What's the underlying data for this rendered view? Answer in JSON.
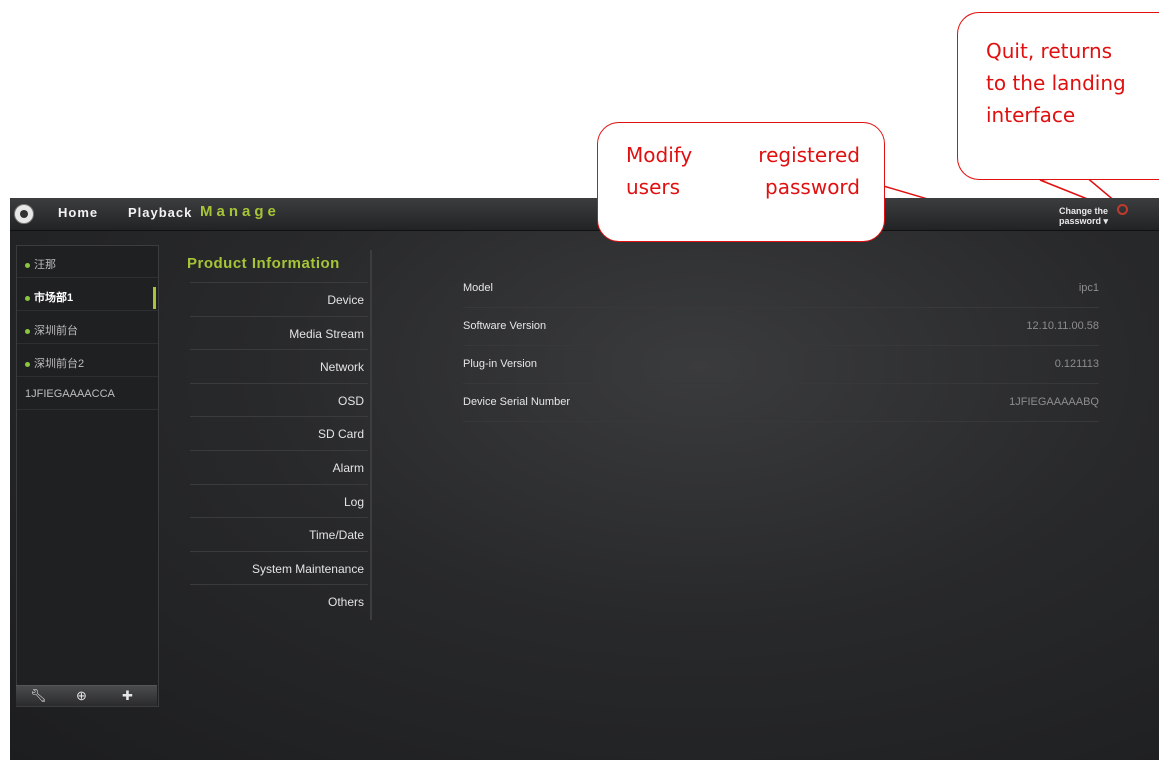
{
  "nav": {
    "home": "Home",
    "playback": "Playback",
    "manage": "Manage",
    "change_password_line1": "Change the",
    "change_password_line2": "password ▾"
  },
  "devices": [
    {
      "label": "汪那",
      "status": "online",
      "selected": false
    },
    {
      "label": "市场部1",
      "status": "online",
      "selected": true
    },
    {
      "label": "深圳前台",
      "status": "online",
      "selected": false
    },
    {
      "label": "深圳前台2",
      "status": "online",
      "selected": false
    },
    {
      "label": "1JFIEGAAAACCA",
      "status": "none",
      "selected": false
    }
  ],
  "device_toolbar": [
    "wrench-icon",
    "zoom-icon",
    "add-icon"
  ],
  "menu": {
    "heading": "Product Information",
    "items": [
      "Device",
      "Media Stream",
      "Network",
      "OSD",
      "SD Card",
      "Alarm",
      "Log",
      "Time/Date",
      "System Maintenance",
      "Others"
    ]
  },
  "info": [
    {
      "label": "Model",
      "value": "ipc1"
    },
    {
      "label": "Software Version",
      "value": "12.10.11.00.58"
    },
    {
      "label": "Plug-in Version",
      "value": "0.121113"
    },
    {
      "label": "Device Serial Number",
      "value": "1JFIEGAAAAABQ"
    }
  ],
  "callouts": {
    "password": "Modify registered users password",
    "quit_line1": "Quit, returns",
    "quit_line2": "to the landing",
    "quit_line3": "interface"
  },
  "colors": {
    "accent": "#a6c437",
    "online_dot": "#8cc63f",
    "callout_red": "#e01010",
    "power_red": "#c03a2e"
  }
}
